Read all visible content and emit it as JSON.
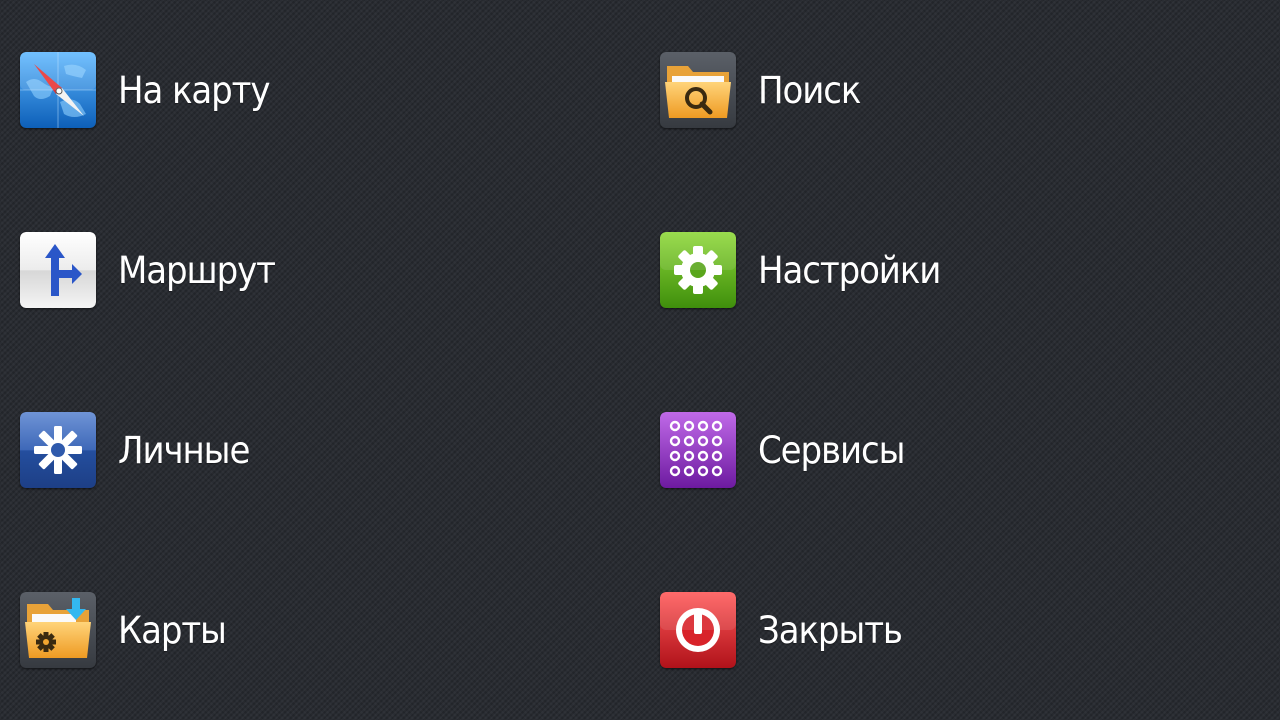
{
  "menu": {
    "items": [
      {
        "label": "На карту",
        "icon": "compass-map-icon"
      },
      {
        "label": "Поиск",
        "icon": "folder-search-icon"
      },
      {
        "label": "Маршрут",
        "icon": "route-arrow-icon"
      },
      {
        "label": "Настройки",
        "icon": "gear-icon"
      },
      {
        "label": "Личные",
        "icon": "asterisk-icon"
      },
      {
        "label": "Сервисы",
        "icon": "dot-grid-icon"
      },
      {
        "label": "Карты",
        "icon": "folder-download-icon"
      },
      {
        "label": "Закрыть",
        "icon": "power-icon"
      }
    ]
  },
  "colors": {
    "background": "#2a2d33",
    "text": "#ffffff",
    "map_blue": "#1e7fd8",
    "route_gray": "#e6e6e6",
    "settings_green": "#5fae1a",
    "personal_blue": "#2c57a5",
    "services_purple": "#8e2fbf",
    "close_red": "#d8232a",
    "folder_orange": "#f3a630"
  }
}
